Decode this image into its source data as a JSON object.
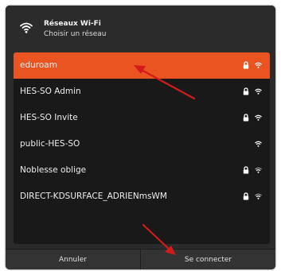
{
  "dialog": {
    "title": "Réseaux Wi-Fi",
    "subtitle": "Choisir un réseau"
  },
  "networks": [
    {
      "name": "eduroam",
      "selected": true,
      "secured": true
    },
    {
      "name": "HES-SO Admin",
      "selected": false,
      "secured": true
    },
    {
      "name": "HES-SO Invite",
      "selected": false,
      "secured": true
    },
    {
      "name": "public-HES-SO",
      "selected": false,
      "secured": false
    },
    {
      "name": "Noblesse oblige",
      "selected": false,
      "secured": true
    },
    {
      "name": "DIRECT-KDSURFACE_ADRIENmsWM",
      "selected": false,
      "secured": true
    }
  ],
  "footer": {
    "cancel_label": "Annuler",
    "connect_label": "Se connecter"
  },
  "colors": {
    "accent": "#e95420",
    "arrow": "#d41b1b"
  }
}
